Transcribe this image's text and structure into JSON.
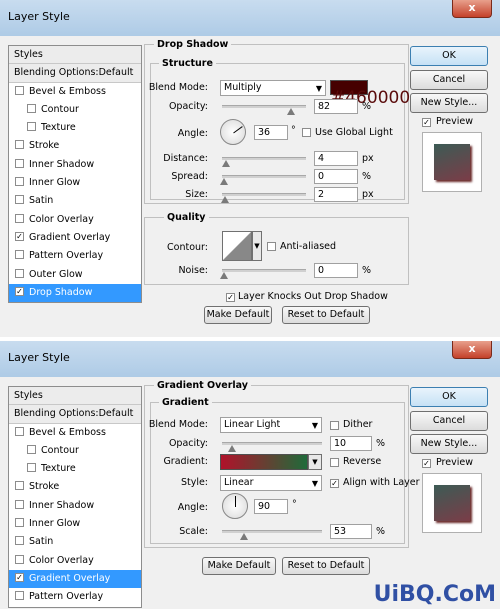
{
  "top_dialog": {
    "title": "Layer Style",
    "close": "x",
    "styles_header": "Styles",
    "blending": "Blending Options:Default",
    "items": [
      {
        "label": "Bevel & Emboss",
        "checked": ""
      },
      {
        "label": "Contour",
        "checked": ""
      },
      {
        "label": "Texture",
        "checked": ""
      },
      {
        "label": "Stroke",
        "checked": ""
      },
      {
        "label": "Inner Shadow",
        "checked": ""
      },
      {
        "label": "Inner Glow",
        "checked": ""
      },
      {
        "label": "Satin",
        "checked": ""
      },
      {
        "label": "Color Overlay",
        "checked": ""
      },
      {
        "label": "Gradient Overlay",
        "checked": "✓"
      },
      {
        "label": "Pattern Overlay",
        "checked": ""
      },
      {
        "label": "Outer Glow",
        "checked": ""
      },
      {
        "label": "Drop Shadow",
        "checked": "✓"
      }
    ],
    "section_title": "Drop Shadow",
    "structure_title": "Structure",
    "blend_mode_label": "Blend Mode:",
    "blend_mode_value": "Multiply",
    "shadow_color": "#460000",
    "hex_note": "#460000",
    "opacity_label": "Opacity:",
    "opacity_value": "82",
    "opacity_unit": "%",
    "angle_label": "Angle:",
    "angle_value": "36",
    "angle_unit": "°",
    "global_light": "Use Global Light",
    "distance_label": "Distance:",
    "distance_value": "4",
    "spread_label": "Spread:",
    "spread_value": "0",
    "size_label": "Size:",
    "size_value": "2",
    "px": "px",
    "pct": "%",
    "quality_title": "Quality",
    "contour_label": "Contour:",
    "anti_aliased": "Anti-aliased",
    "noise_label": "Noise:",
    "noise_value": "0",
    "knockout": "Layer Knocks Out Drop Shadow",
    "make_default": "Make Default",
    "reset_default": "Reset to Default",
    "ok": "OK",
    "cancel": "Cancel",
    "new_style": "New Style...",
    "preview": "Preview"
  },
  "bottom_dialog": {
    "title": "Layer Style",
    "close": "x",
    "styles_header": "Styles",
    "blending": "Blending Options:Default",
    "items": [
      {
        "label": "Bevel & Emboss",
        "checked": ""
      },
      {
        "label": "Contour",
        "checked": ""
      },
      {
        "label": "Texture",
        "checked": ""
      },
      {
        "label": "Stroke",
        "checked": ""
      },
      {
        "label": "Inner Shadow",
        "checked": ""
      },
      {
        "label": "Inner Glow",
        "checked": ""
      },
      {
        "label": "Satin",
        "checked": ""
      },
      {
        "label": "Color Overlay",
        "checked": ""
      },
      {
        "label": "Gradient Overlay",
        "checked": "✓"
      },
      {
        "label": "Pattern Overlay",
        "checked": ""
      }
    ],
    "section_title": "Gradient Overlay",
    "gradient_title": "Gradient",
    "blend_mode_label": "Blend Mode:",
    "blend_mode_value": "Linear Light",
    "dither": "Dither",
    "opacity_label": "Opacity:",
    "opacity_value": "10",
    "pct": "%",
    "gradient_label": "Gradient:",
    "gradient_colors": [
      "#b0122a",
      "#1f6b3a"
    ],
    "reverse": "Reverse",
    "style_label": "Style:",
    "style_value": "Linear",
    "align": "Align with Layer",
    "angle_label": "Angle:",
    "angle_value": "90",
    "angle_unit": "°",
    "scale_label": "Scale:",
    "scale_value": "53",
    "make_default": "Make Default",
    "reset_default": "Reset to Default",
    "ok": "OK",
    "cancel": "Cancel",
    "new_style": "New Style...",
    "preview": "Preview"
  },
  "watermark": "UiBQ.CoM"
}
